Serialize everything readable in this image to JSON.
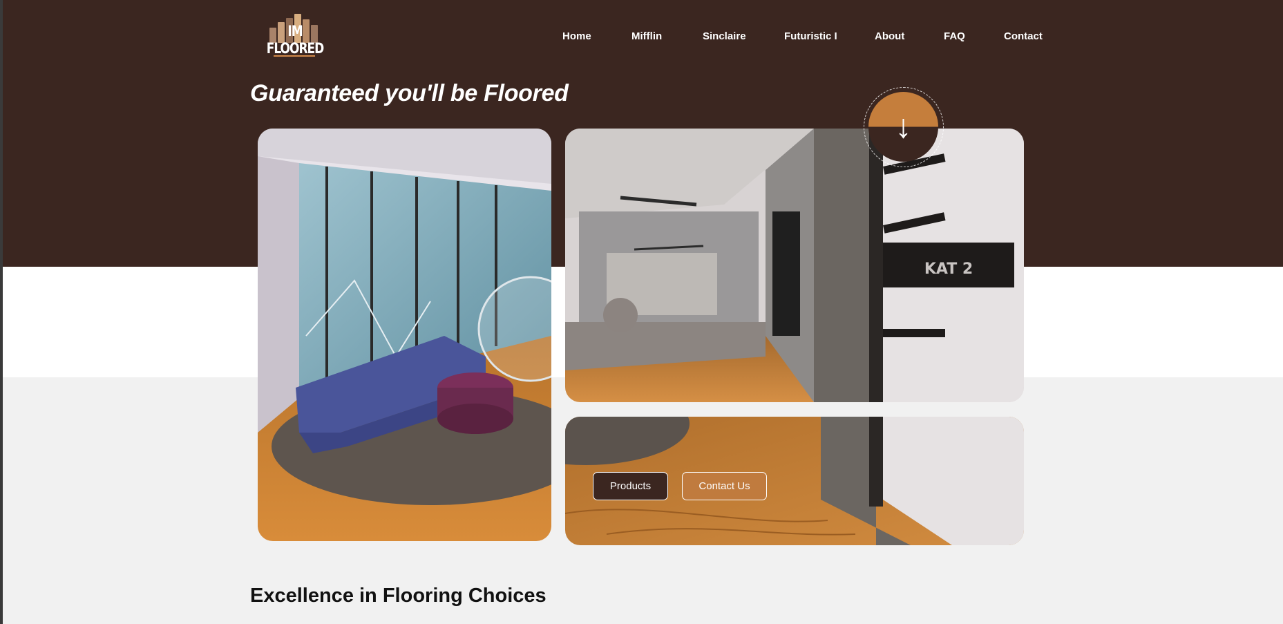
{
  "brand": {
    "logo_text": "IM FLOORED"
  },
  "nav": {
    "items": [
      "Home",
      "Mifflin",
      "Sinclaire",
      "Futuristic I",
      "About",
      "FAQ",
      "Contact"
    ]
  },
  "hero": {
    "title": "Guaranteed you'll be Floored",
    "scroll_icon": "arrow-down-icon",
    "buttons": {
      "products": "Products",
      "contact": "Contact Us"
    },
    "images": {
      "left": "office-lounge-photo",
      "right": "office-hallway-photo",
      "bottom": "wood-floor-hallway-photo"
    },
    "sign_text": "KAT 2"
  },
  "section": {
    "title": "Excellence in Flooring Choices"
  },
  "colors": {
    "dark_brown": "#3b2620",
    "copper": "#c57e3c",
    "light_grey": "#f1f1f1",
    "white": "#ffffff"
  }
}
